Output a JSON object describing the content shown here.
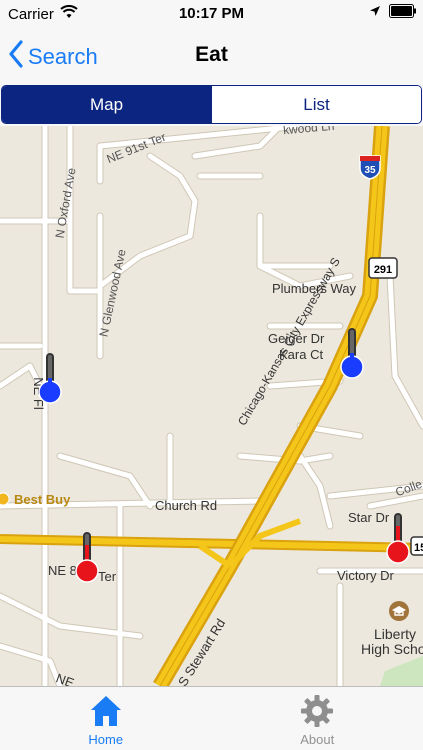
{
  "status_bar": {
    "carrier": "Carrier",
    "time": "10:17 PM",
    "icons": [
      "wifi-icon",
      "location-arrow-icon",
      "battery-icon"
    ]
  },
  "nav": {
    "back_label": "Search",
    "title": "Eat"
  },
  "segmented": {
    "map_label": "Map",
    "list_label": "List",
    "selected": "Map"
  },
  "map": {
    "labels": {
      "kwood": "kwood Ln",
      "ne91st": "NE 91st Ter",
      "noxford": "N Oxford Ave",
      "nglenwood": "N Glenwood Ave",
      "plumbers": "Plumbers Way",
      "geiger": "Geiger Dr",
      "kara": "Kara Ct",
      "expressway": "Chicago-Kansas City Expressway S",
      "nefl": "NE Fl",
      "bestbuy": "Best Buy",
      "church": "Church Rd",
      "college": "Colle",
      "star": "Star Dr",
      "ne8": "NE 8",
      "ter": "Ter",
      "victory": "Victory Dr",
      "stewart": "S Stewart Rd",
      "liberty": "Liberty",
      "highschool": "High Scho",
      "ne_bottom": "NE"
    },
    "shields": {
      "interstate": "35",
      "state": "291",
      "route_partial": "15"
    },
    "markers": [
      {
        "name": "cool-venue-marker-1",
        "level": "cold",
        "color": "#1a3cff"
      },
      {
        "name": "cool-venue-marker-2",
        "level": "cold",
        "color": "#1a3cff"
      },
      {
        "name": "hot-venue-marker-1",
        "level": "hot",
        "color": "#e8141c"
      },
      {
        "name": "hot-venue-marker-2",
        "level": "hot",
        "color": "#e8141c"
      }
    ],
    "colors": {
      "land": "#ede8dd",
      "road": "#ffffff",
      "road_outline": "#cfc7b6",
      "highway": "#f5c61a",
      "highway_outline": "#d9a20e"
    }
  },
  "tabs": [
    {
      "label": "Home",
      "icon": "home-icon",
      "active": true
    },
    {
      "label": "About",
      "icon": "gear-icon",
      "active": false
    }
  ]
}
